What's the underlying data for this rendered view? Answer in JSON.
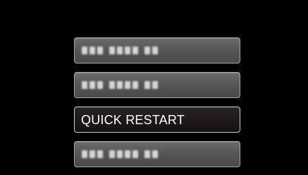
{
  "menu": {
    "items": [
      {
        "label": "",
        "state": "obscured"
      },
      {
        "label": "",
        "state": "obscured"
      },
      {
        "label": "QUICK RESTART",
        "state": "selected"
      },
      {
        "label": "",
        "state": "obscured"
      }
    ]
  },
  "colors": {
    "background": "#000000",
    "item_fill": "#5a5a5a",
    "item_border": "#a6a6a6",
    "selected_fill": "#1f1819",
    "text": "#ffffff"
  }
}
